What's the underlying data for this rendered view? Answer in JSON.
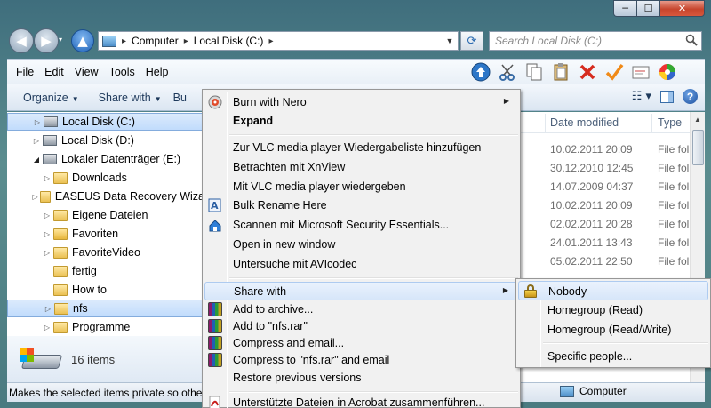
{
  "window": {
    "min_icon": "─",
    "max_icon": "☐",
    "close_icon": "✕"
  },
  "nav": {
    "back_icon": "◀",
    "forward_icon": "▶",
    "history_icon": "▾",
    "up_icon": "▲",
    "breadcrumb": [
      "Computer",
      "Local Disk (C:)"
    ],
    "refresh_icon": "⟳",
    "search_placeholder": "Search Local Disk (C:)"
  },
  "menubar": {
    "items": [
      "File",
      "Edit",
      "View",
      "Tools",
      "Help"
    ],
    "toolbar_icons": [
      "up-arrow-icon",
      "cut-icon",
      "copy-icon",
      "paste-icon",
      "delete-icon",
      "check-icon",
      "properties-icon",
      "color-wheel-icon"
    ]
  },
  "commandbar": {
    "organize": "Organize",
    "share_with": "Share with",
    "burn": "Bu"
  },
  "tree": [
    {
      "label": "Local Disk (C:)",
      "type": "drive",
      "selected": true
    },
    {
      "label": "Local Disk (D:)",
      "type": "drive"
    },
    {
      "label": "Lokaler Datenträger (E:)",
      "type": "drive",
      "expanded": true
    },
    {
      "label": "Downloads",
      "type": "folder"
    },
    {
      "label": "EASEUS Data Recovery Wiza",
      "type": "folder"
    },
    {
      "label": "Eigene Dateien",
      "type": "folder"
    },
    {
      "label": "Favoriten",
      "type": "folder"
    },
    {
      "label": "FavoriteVideo",
      "type": "folder"
    },
    {
      "label": "fertig",
      "type": "folder"
    },
    {
      "label": "How to",
      "type": "folder"
    },
    {
      "label": "nfs",
      "type": "folder",
      "selected": true
    },
    {
      "label": "Programme",
      "type": "folder"
    }
  ],
  "details": {
    "count": "16 items"
  },
  "status": {
    "text": "Makes the selected items private so other",
    "location": "Computer"
  },
  "columns": {
    "date_modified": "Date modified",
    "type": "Type"
  },
  "files": [
    {
      "date": "10.02.2011 20:09",
      "type": "File fol"
    },
    {
      "date": "30.12.2010 12:45",
      "type": "File fol"
    },
    {
      "date": "14.07.2009 04:37",
      "type": "File fol"
    },
    {
      "date": "10.02.2011 20:09",
      "type": "File fol"
    },
    {
      "date": "02.02.2011 20:28",
      "type": "File fol"
    },
    {
      "date": "24.01.2011 13:43",
      "type": "File fol"
    },
    {
      "date": "05.02.2011 22:50",
      "type": "File fol"
    }
  ],
  "context_menu": {
    "burn_nero": "Burn with Nero",
    "expand": "Expand",
    "vlc_playlist": "Zur VLC media player Wiedergabeliste hinzufügen",
    "xnview": "Betrachten mit XnView",
    "vlc_play": "Mit VLC media player wiedergeben",
    "bulk_rename": "Bulk Rename Here",
    "mse_scan": "Scannen mit Microsoft Security Essentials...",
    "new_window": "Open in new window",
    "avicodec": "Untersuche mit AVIcodec",
    "share_with": "Share with",
    "add_archive": "Add to archive...",
    "add_rar": "Add to \"nfs.rar\"",
    "compress_email": "Compress and email...",
    "compress_rar_email": "Compress to \"nfs.rar\" and email",
    "restore": "Restore previous versions",
    "acrobat": "Unterstützte Dateien in Acrobat zusammenführen..."
  },
  "share_submenu": {
    "nobody": "Nobody",
    "homegroup_read": "Homegroup (Read)",
    "homegroup_rw": "Homegroup (Read/Write)",
    "specific": "Specific people..."
  },
  "colors": {
    "accent": "#3399ff",
    "selection": "#cce4fc",
    "menu_bg": "#f1f1f1",
    "delete_x": "#d62b1e",
    "check": "#f08a18"
  }
}
